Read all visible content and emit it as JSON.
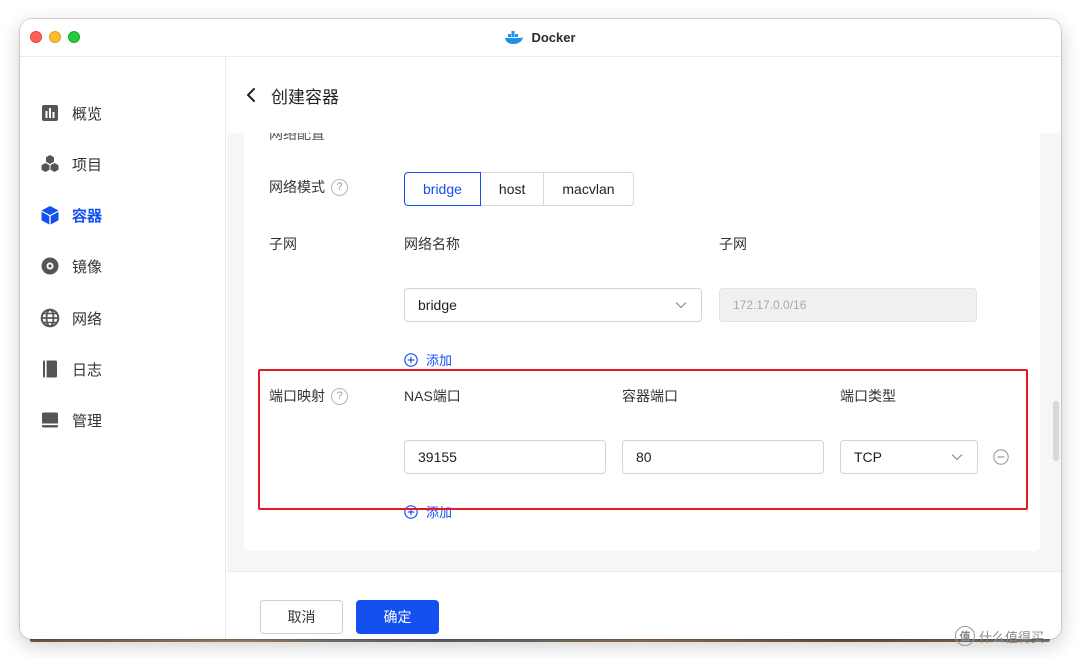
{
  "window": {
    "title": "Docker"
  },
  "sidebar": {
    "items": [
      {
        "label": "概览",
        "icon": "overview-icon",
        "active": false
      },
      {
        "label": "项目",
        "icon": "project-icon",
        "active": false
      },
      {
        "label": "容器",
        "icon": "container-icon",
        "active": true
      },
      {
        "label": "镜像",
        "icon": "image-icon",
        "active": false
      },
      {
        "label": "网络",
        "icon": "network-icon",
        "active": false
      },
      {
        "label": "日志",
        "icon": "log-icon",
        "active": false
      },
      {
        "label": "管理",
        "icon": "manage-icon",
        "active": false
      }
    ]
  },
  "header": {
    "title": "创建容器"
  },
  "form": {
    "clipped_section_label": "网络配置",
    "network_mode": {
      "label": "网络模式",
      "help": "?",
      "options": [
        "bridge",
        "host",
        "macvlan"
      ],
      "selected": "bridge"
    },
    "subnet": {
      "label": "子网",
      "network_name_header": "网络名称",
      "subnet_header": "子网",
      "network_name_value": "bridge",
      "subnet_value": "172.17.0.0/16",
      "add_label": "添加"
    },
    "port_mapping": {
      "label": "端口映射",
      "help": "?",
      "nas_port_header": "NAS端口",
      "container_port_header": "容器端口",
      "port_type_header": "端口类型",
      "nas_port_value": "39155",
      "container_port_value": "80",
      "port_type_value": "TCP",
      "add_label": "添加"
    }
  },
  "footer": {
    "cancel_label": "取消",
    "confirm_label": "确定"
  },
  "watermark": {
    "logo_char": "值",
    "text": "什么值得买"
  },
  "colors": {
    "accent": "#1450f0",
    "highlight": "#e31a25"
  }
}
